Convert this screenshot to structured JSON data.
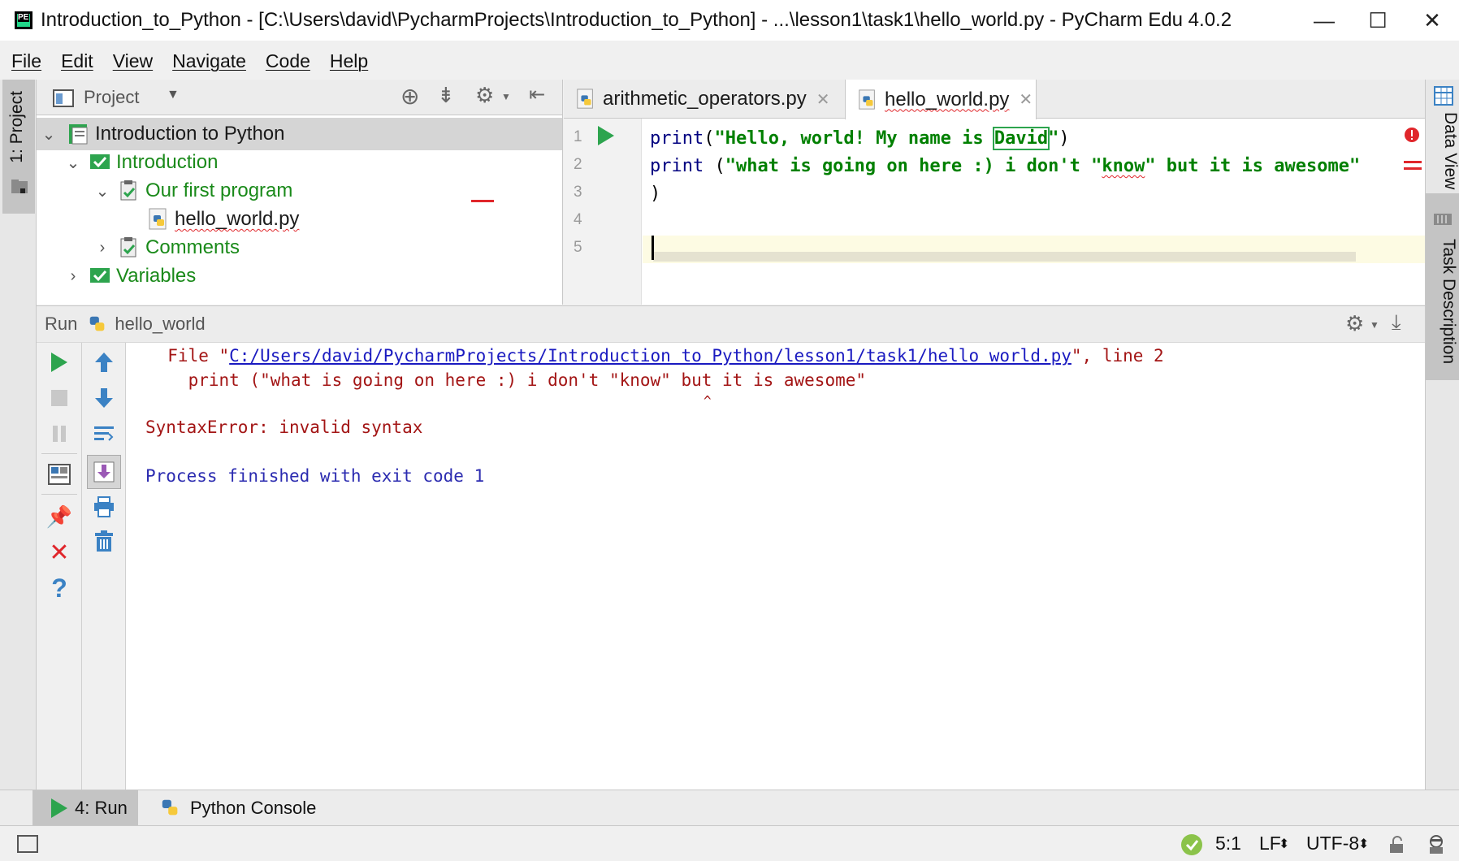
{
  "window": {
    "title": "Introduction_to_Python - [C:\\Users\\david\\PycharmProjects\\Introduction_to_Python] - ...\\lesson1\\task1\\hello_world.py - PyCharm Edu 4.0.2",
    "minimize": "—",
    "maximize": "☐",
    "close": "✕"
  },
  "menu": [
    "File",
    "Edit",
    "View",
    "Navigate",
    "Code",
    "Help"
  ],
  "left_strip": {
    "project_tab": "1: Project"
  },
  "right_strip": {
    "data_view": "Data View",
    "task_description": "Task Description"
  },
  "project": {
    "header": "Project",
    "tree": [
      {
        "label": "Introduction to Python"
      },
      {
        "label": "Introduction"
      },
      {
        "label": "Our first program"
      },
      {
        "label": "hello_world.py"
      },
      {
        "label": "Comments"
      },
      {
        "label": "Variables"
      }
    ]
  },
  "editor": {
    "tabs": [
      "arithmetic_operators.py",
      "hello_world.py"
    ],
    "line_numbers": [
      "1",
      "2",
      "3",
      "4",
      "5"
    ],
    "line1": {
      "fn": "print",
      "open": "(",
      "str_a": "\"Hello, world! My name is ",
      "highlight": "David",
      "str_b": "\"",
      "close": ")"
    },
    "line2": {
      "fn": "print",
      "open": " (",
      "str_a": "\"what is going on here :) i don't \"",
      "know": "know",
      "str_b": "\" but it is awesome\""
    },
    "line3": ")"
  },
  "run": {
    "label": "Run",
    "config": "hello_world",
    "console": {
      "file_prefix": "  File \"",
      "file_path": "C:/Users/david/PycharmProjects/Introduction to Python/lesson1/task1/hello world.py",
      "file_suffix": "\", line 2",
      "code_line": "    print (\"what is going on here :) i don't \"know\" but it is awesome\"",
      "caret": "^",
      "error": "SyntaxError: invalid syntax",
      "exit": "Process finished with exit code 1"
    }
  },
  "bottom_tabs": {
    "run": "4: Run",
    "console": "Python Console"
  },
  "status": {
    "position": "5:1",
    "line_sep": "LF",
    "encoding": "UTF-8"
  },
  "colors": {
    "accent_green": "#21a021",
    "error_red": "#a31515",
    "link_blue": "#1a1ac0"
  }
}
